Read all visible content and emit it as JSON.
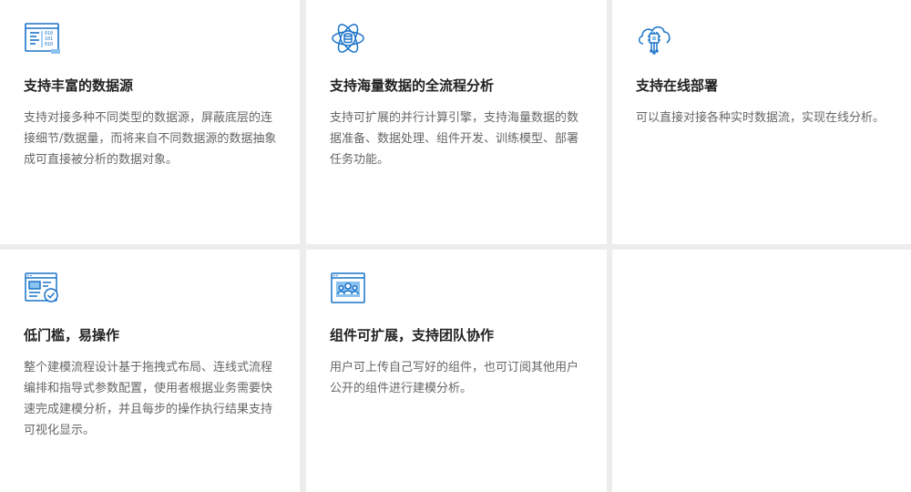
{
  "colors": {
    "icon_primary": "#1a73c9",
    "icon_light": "#8cc2ee",
    "title": "#222222",
    "text": "#666666",
    "card_bg": "#ffffff",
    "gap_bg": "#ededed"
  },
  "features": [
    {
      "icon": "data-source-code-icon",
      "title": "支持丰富的数据源",
      "description": "支持对接多种不同类型的数据源，屏蔽底层的连接细节/数据量，而将来自不同数据源的数据抽象成可直接被分析的数据对象。"
    },
    {
      "icon": "atom-database-icon",
      "title": "支持海量数据的全流程分析",
      "description": "支持可扩展的并行计算引擎，支持海量数据的数据准备、数据处理、组件开发、训练模型、部署任务功能。"
    },
    {
      "icon": "cloud-chip-icon",
      "title": "支持在线部署",
      "description": "可以直接对接各种实时数据流，实现在线分析。"
    },
    {
      "icon": "window-check-icon",
      "title": "低门槛，易操作",
      "description": "整个建模流程设计基于拖拽式布局、连线式流程编排和指导式参数配置，使用者根据业务需要快速完成建模分析，并且每步的操作执行结果支持可视化显示。"
    },
    {
      "icon": "window-team-icon",
      "title": "组件可扩展，支持团队协作",
      "description": "用户可上传自己写好的组件，也可订阅其他用户公开的组件进行建模分析。"
    }
  ]
}
